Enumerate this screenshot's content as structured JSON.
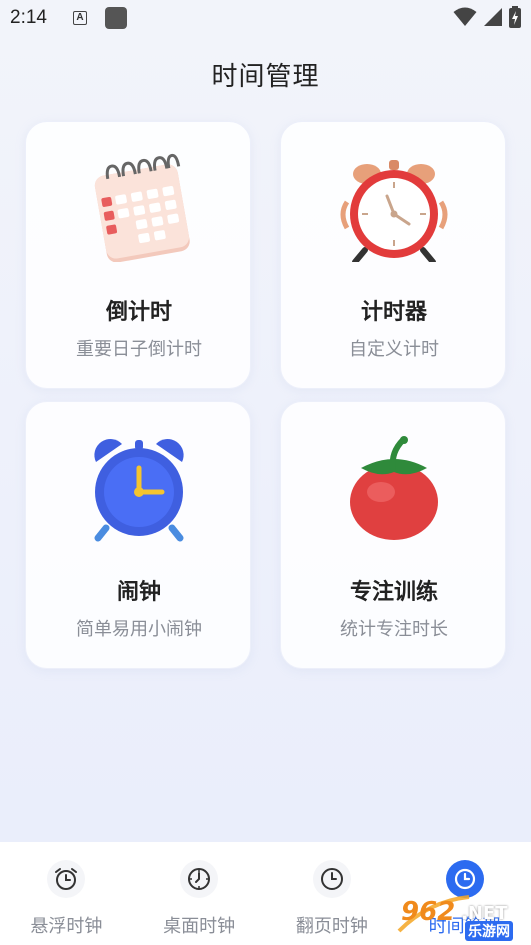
{
  "status_bar": {
    "time": "2:14",
    "a_icon": "A"
  },
  "page_title": "时间管理",
  "cards": [
    {
      "title": "倒计时",
      "subtitle": "重要日子倒计时",
      "icon": "calendar-icon"
    },
    {
      "title": "计时器",
      "subtitle": "自定义计时",
      "icon": "red-alarm-clock-icon"
    },
    {
      "title": "闹钟",
      "subtitle": "简单易用小闹钟",
      "icon": "blue-alarm-clock-icon"
    },
    {
      "title": "专注训练",
      "subtitle": "统计专注时长",
      "icon": "tomato-icon"
    }
  ],
  "bottom_nav": {
    "items": [
      {
        "label": "悬浮时钟",
        "icon": "alarm-clock-icon",
        "active": false
      },
      {
        "label": "桌面时钟",
        "icon": "clock-icon",
        "active": false
      },
      {
        "label": "翻页时钟",
        "icon": "clock-icon",
        "active": false
      },
      {
        "label": "时间管理",
        "icon": "clock-icon",
        "active": true
      }
    ]
  },
  "watermark": {
    "text": "962",
    "suffix": ".NET",
    "sub": "乐游网"
  },
  "colors": {
    "accent": "#2c6bf0",
    "subtitle": "#8a8e97",
    "title": "#222222"
  }
}
